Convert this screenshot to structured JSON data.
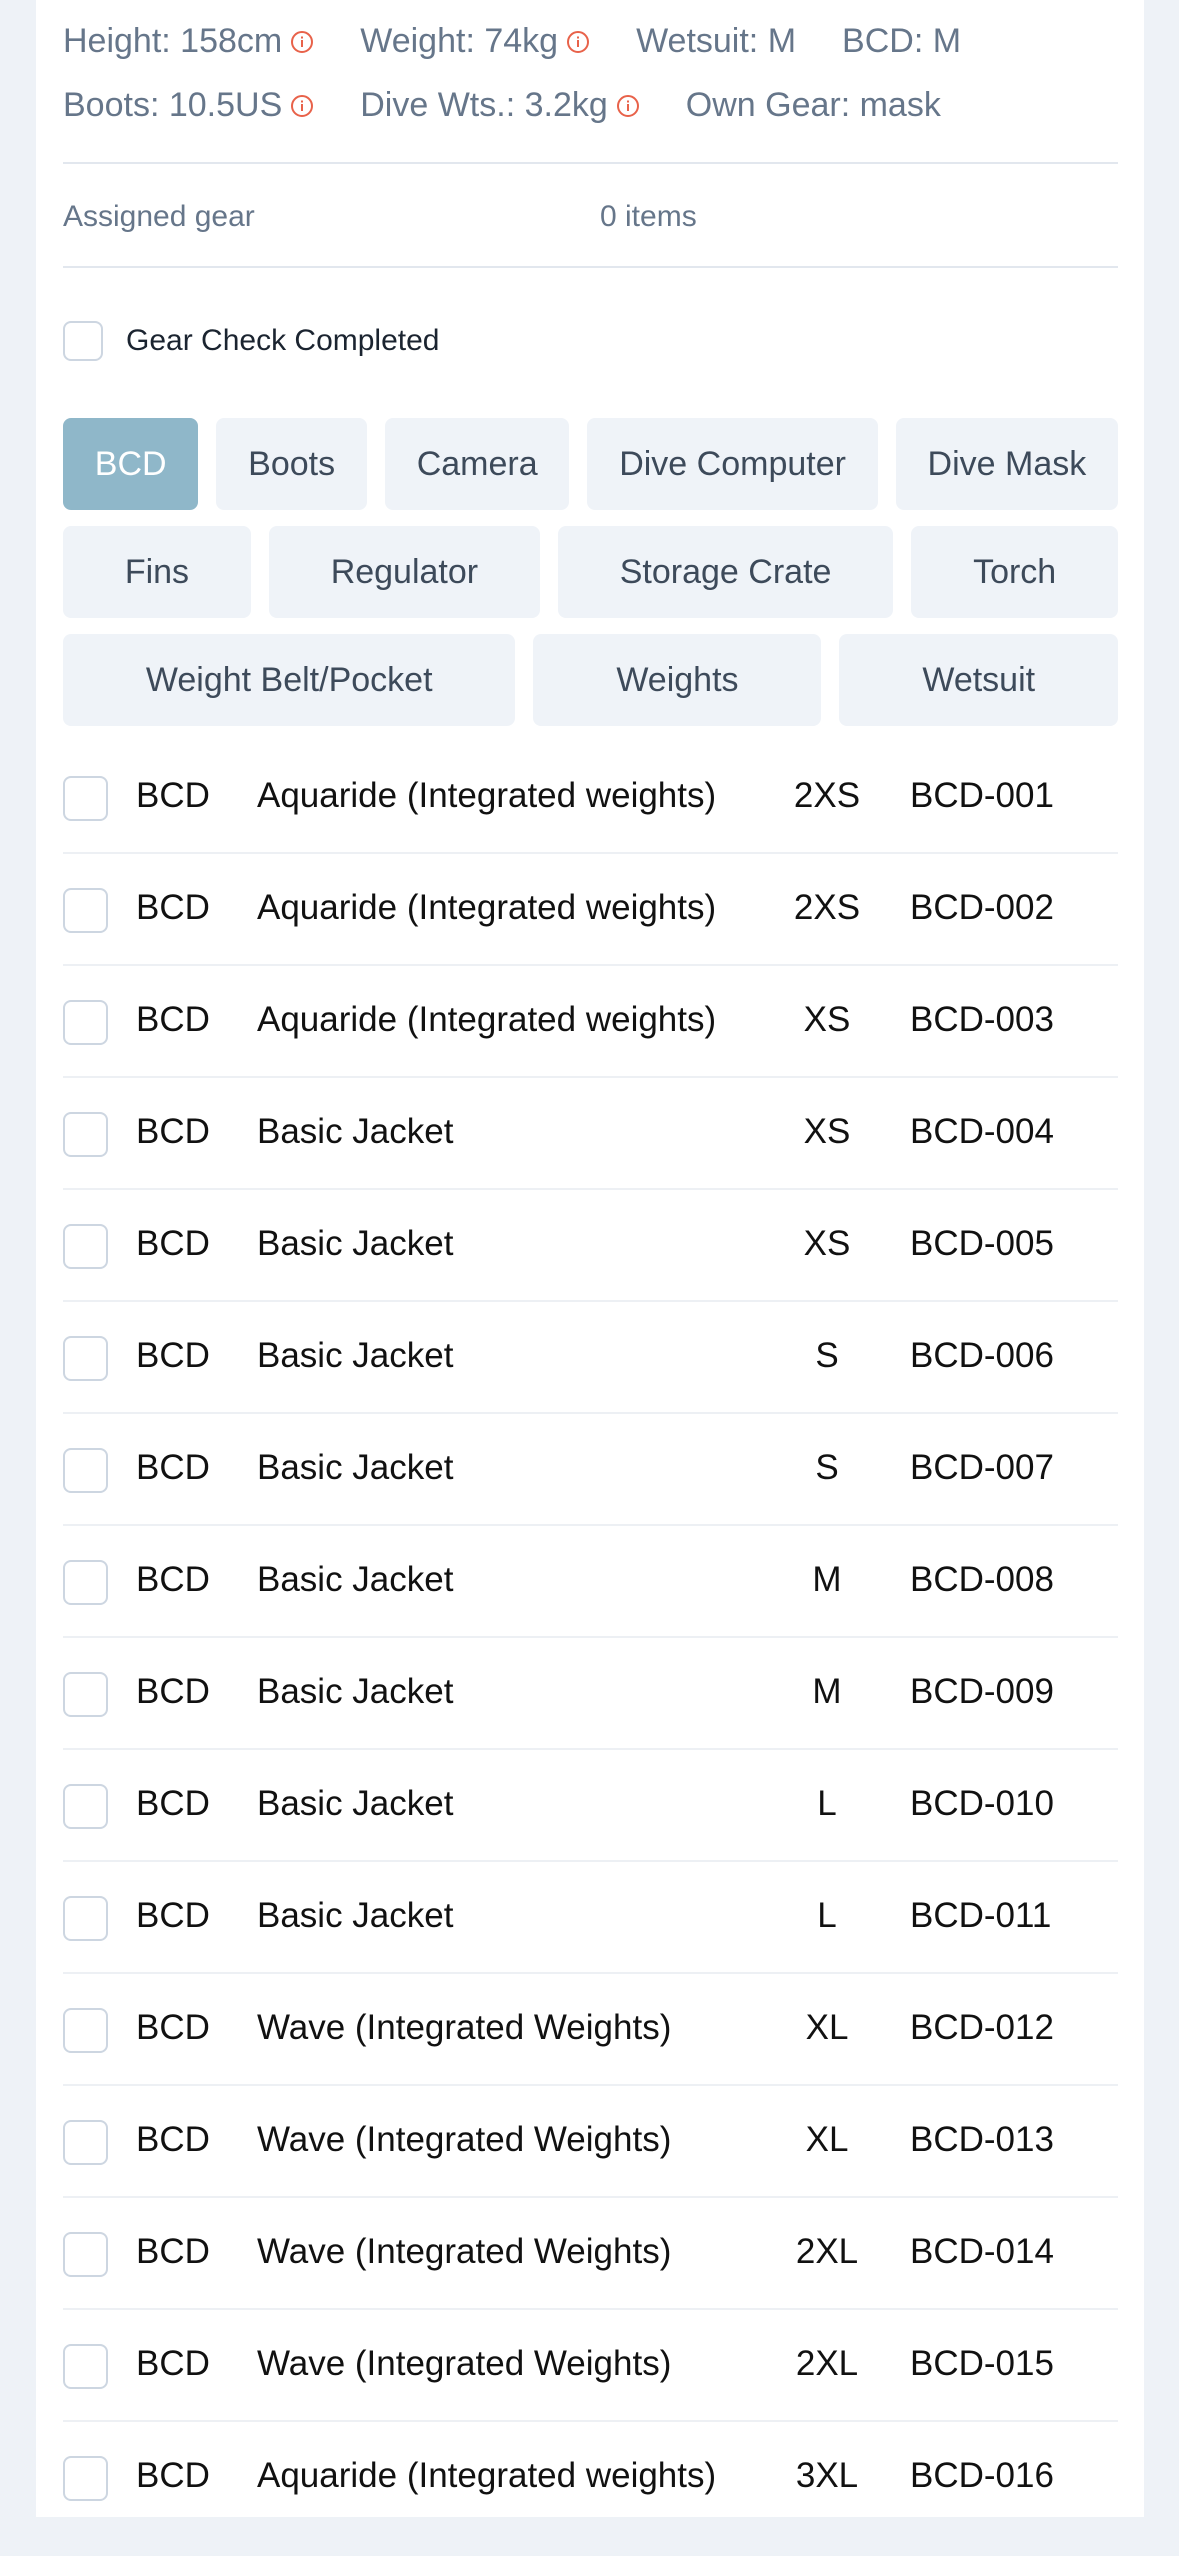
{
  "profile": {
    "height": "Height: 158cm",
    "weight": "Weight: 74kg",
    "wetsuit": "Wetsuit: M",
    "bcd": "BCD: M",
    "boots": "Boots: 10.5US",
    "dive_wts": "Dive Wts.: 3.2kg",
    "own_gear": "Own Gear: mask"
  },
  "assigned": {
    "label": "Assigned gear",
    "count": "0 items"
  },
  "gear_check": {
    "label": "Gear Check Completed",
    "checked": false
  },
  "categories": [
    [
      "BCD",
      "Boots",
      "Camera",
      "Dive Computer",
      "Dive Mask"
    ],
    [
      "Fins",
      "Regulator",
      "Storage Crate",
      "Torch"
    ],
    [
      "Weight Belt/Pocket",
      "Weights",
      "Wetsuit"
    ]
  ],
  "active_category": "BCD",
  "items": [
    {
      "type": "BCD",
      "name": "Aquaride (Integrated weights)",
      "size": "2XS",
      "code": "BCD-001"
    },
    {
      "type": "BCD",
      "name": "Aquaride (Integrated weights)",
      "size": "2XS",
      "code": "BCD-002"
    },
    {
      "type": "BCD",
      "name": "Aquaride (Integrated weights)",
      "size": "XS",
      "code": "BCD-003"
    },
    {
      "type": "BCD",
      "name": "Basic Jacket",
      "size": "XS",
      "code": "BCD-004"
    },
    {
      "type": "BCD",
      "name": "Basic Jacket",
      "size": "XS",
      "code": "BCD-005"
    },
    {
      "type": "BCD",
      "name": "Basic Jacket",
      "size": "S",
      "code": "BCD-006"
    },
    {
      "type": "BCD",
      "name": "Basic Jacket",
      "size": "S",
      "code": "BCD-007"
    },
    {
      "type": "BCD",
      "name": "Basic Jacket",
      "size": "M",
      "code": "BCD-008"
    },
    {
      "type": "BCD",
      "name": "Basic Jacket",
      "size": "M",
      "code": "BCD-009"
    },
    {
      "type": "BCD",
      "name": "Basic Jacket",
      "size": "L",
      "code": "BCD-010"
    },
    {
      "type": "BCD",
      "name": "Basic Jacket",
      "size": "L",
      "code": "BCD-011"
    },
    {
      "type": "BCD",
      "name": "Wave (Integrated Weights)",
      "size": "XL",
      "code": "BCD-012"
    },
    {
      "type": "BCD",
      "name": "Wave (Integrated Weights)",
      "size": "XL",
      "code": "BCD-013"
    },
    {
      "type": "BCD",
      "name": "Wave (Integrated Weights)",
      "size": "2XL",
      "code": "BCD-014"
    },
    {
      "type": "BCD",
      "name": "Wave (Integrated Weights)",
      "size": "2XL",
      "code": "BCD-015"
    },
    {
      "type": "BCD",
      "name": "Aquaride (Integrated weights)",
      "size": "3XL",
      "code": "BCD-016"
    }
  ],
  "colors": {
    "accent": "#8fb7c9",
    "warning_icon": "#e8624a",
    "muted_text": "#66768a"
  },
  "icons": {
    "info": "info-circle-icon"
  }
}
